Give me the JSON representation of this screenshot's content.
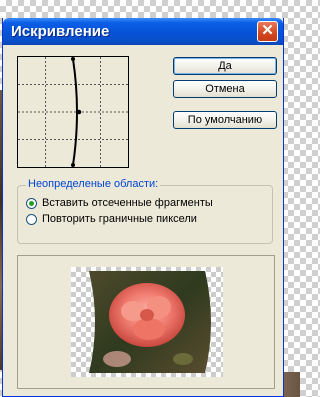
{
  "dialog": {
    "title": "Искривление",
    "close_glyph": "✕",
    "buttons": {
      "ok": "Да",
      "cancel": "Отмена",
      "default": "По умолчанию"
    },
    "undefined_areas": {
      "label": "Неопределеные области:",
      "options": [
        {
          "label": "Вставить отсеченные фрагменты",
          "selected": true
        },
        {
          "label": "Повторить граничные пиксели",
          "selected": false
        }
      ]
    }
  },
  "colors": {
    "titlebar": "#0653d6",
    "close_button": "#d4471f",
    "dialog_face": "#ece9d8",
    "group_label": "#0046d5",
    "rose": "#f07a6e"
  },
  "icons": [
    "close-icon",
    "radio-selected-icon",
    "radio-empty-icon"
  ]
}
